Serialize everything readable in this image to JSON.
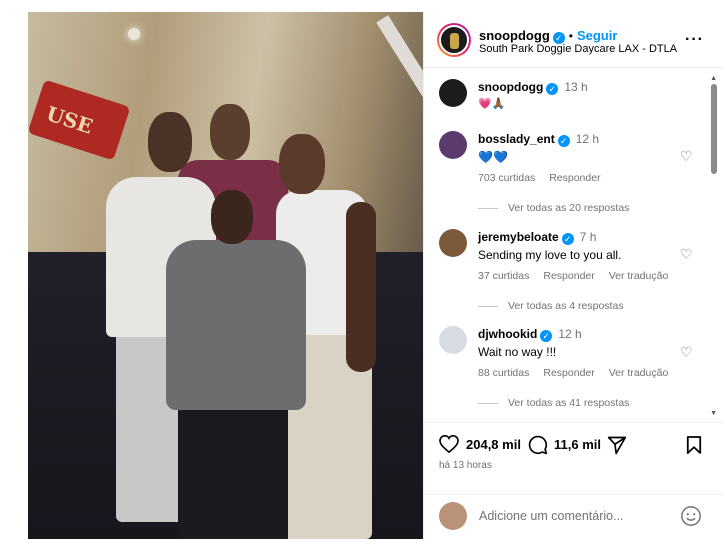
{
  "post": {
    "image_alt": "Group photo of four people",
    "mural_sign": "USE"
  },
  "header": {
    "username": "snoopdogg",
    "separator": "•",
    "follow_label": "Seguir",
    "location": "South Park Doggie Daycare LAX - DTLA",
    "more_icon": "more-horizontal-icon"
  },
  "caption": {
    "username": "snoopdogg",
    "time": "13 h",
    "emojis": "💗🙏🏾"
  },
  "comments": [
    {
      "username": "bosslady_ent",
      "time": "12 h",
      "text": "💙💙",
      "likes": "703 curtidas",
      "reply": "Responder",
      "translate": "",
      "replies": "Ver todas as 20 respostas"
    },
    {
      "username": "jeremybeloate",
      "time": "7 h",
      "text": "Sending my love to you all.",
      "likes": "37 curtidas",
      "reply": "Responder",
      "translate": "Ver tradução",
      "replies": "Ver todas as 4 respostas"
    },
    {
      "username": "djwhookid",
      "time": "12 h",
      "text": "Wait no way !!!",
      "likes": "88 curtidas",
      "reply": "Responder",
      "translate": "Ver tradução",
      "replies": "Ver todas as 41 respostas"
    }
  ],
  "actions": {
    "like_count": "204,8 mil",
    "comment_count": "11,6 mil",
    "posted_ago": "há 13 horas"
  },
  "add_comment": {
    "placeholder": "Adicione um comentário..."
  },
  "colors": {
    "accent": "#0095f6",
    "muted": "#737373",
    "heart": "#ed4956"
  }
}
